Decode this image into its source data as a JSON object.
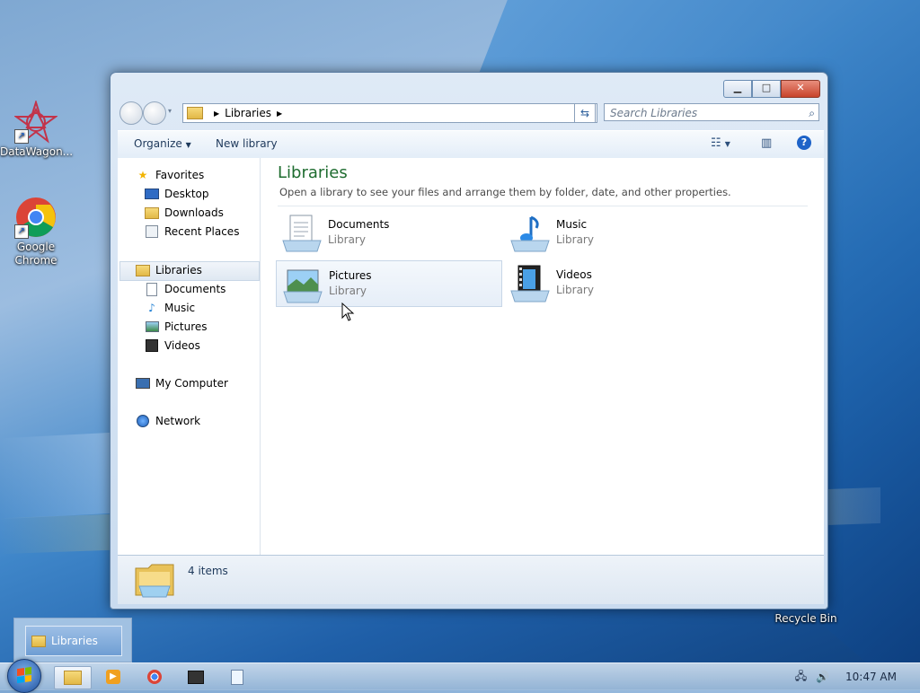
{
  "desktop": {
    "icons": [
      {
        "label": "DataWagon..."
      },
      {
        "label": "Google Chrome"
      },
      {
        "label": "Recycle Bin"
      }
    ]
  },
  "window": {
    "controls": {
      "minimize": "▁",
      "maximize": "□",
      "close": "✕"
    },
    "address": {
      "crumb": "Libraries"
    },
    "search": {
      "placeholder": "Search Libraries"
    },
    "toolbar": {
      "organize": "Organize",
      "new_library": "New library",
      "help": "?"
    },
    "nav": {
      "favorites": "Favorites",
      "desktop": "Desktop",
      "downloads": "Downloads",
      "recent": "Recent Places",
      "libraries": "Libraries",
      "documents": "Documents",
      "music": "Music",
      "pictures": "Pictures",
      "videos": "Videos",
      "computer": "My Computer",
      "network": "Network"
    },
    "main": {
      "title": "Libraries",
      "subtitle": "Open a library to see your files and arrange them by folder, date, and other properties.",
      "tiles": [
        {
          "name": "Documents",
          "type": "Library"
        },
        {
          "name": "Music",
          "type": "Library"
        },
        {
          "name": "Pictures",
          "type": "Library"
        },
        {
          "name": "Videos",
          "type": "Library"
        }
      ]
    },
    "status": {
      "items": "4 items"
    }
  },
  "taskbar": {
    "thumb_label": "Libraries",
    "clock": "10:47 AM"
  },
  "colors": {
    "title_green": "#1e6c2f",
    "selection": "#e6eef8"
  }
}
